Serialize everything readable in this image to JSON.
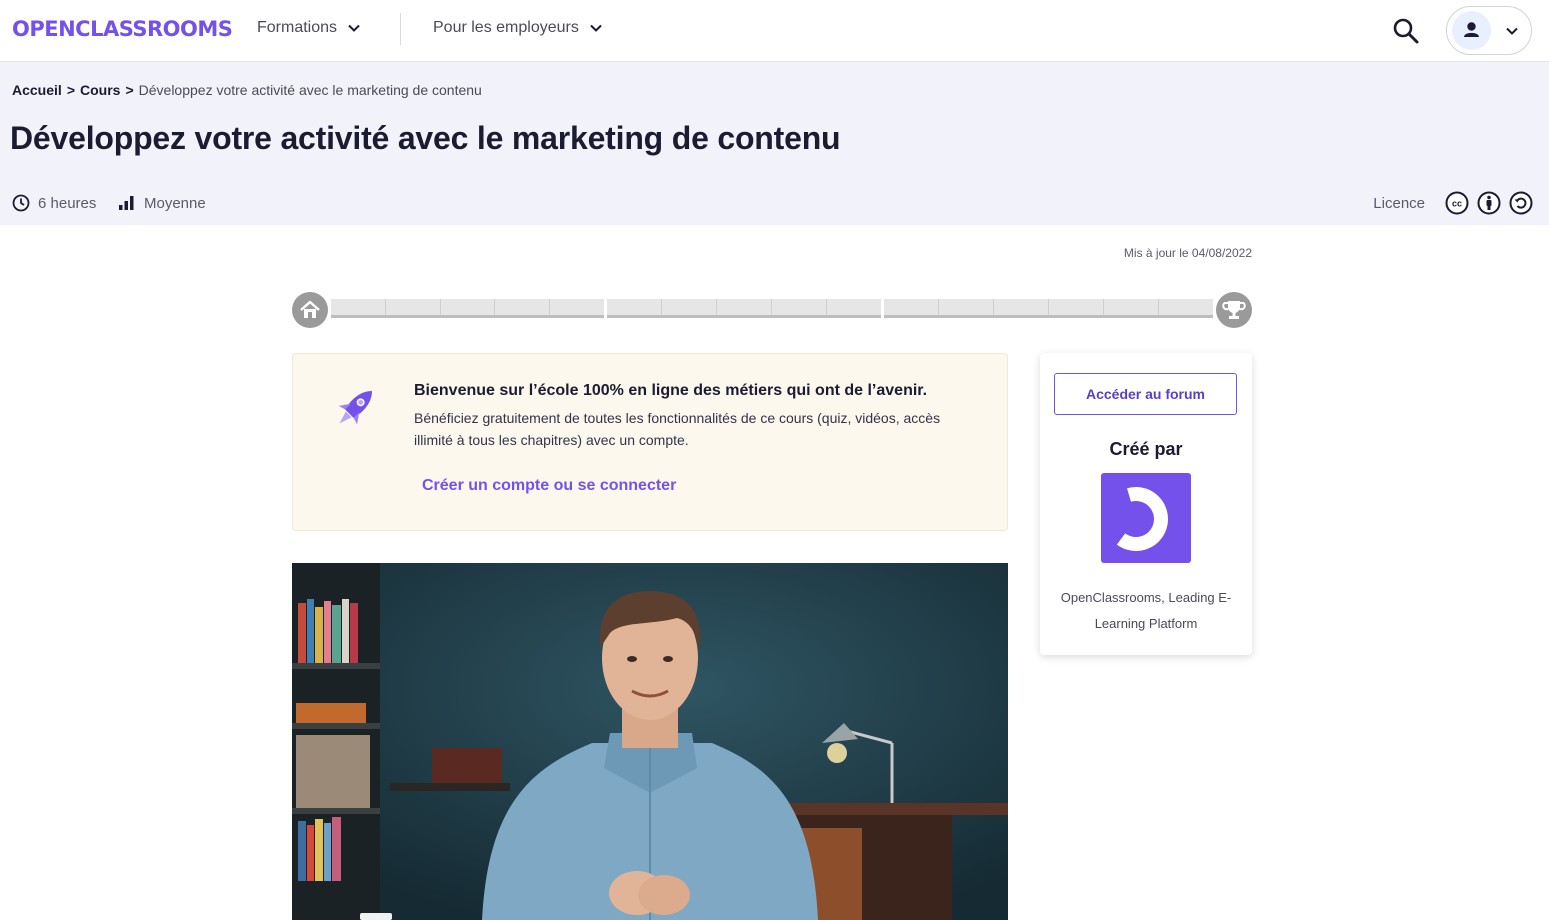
{
  "nav": {
    "logo": "OPENCLASSROOMS",
    "formations": "Formations",
    "employeurs": "Pour les employeurs"
  },
  "breadcrumb": {
    "home": "Accueil",
    "sep1": ">",
    "cours": "Cours",
    "sep2": ">",
    "current": "Développez votre activité avec le marketing de contenu"
  },
  "course": {
    "title": "Développez votre activité avec le marketing de contenu",
    "duration": "6 heures",
    "difficulty": "Moyenne",
    "licence_label": "Licence",
    "updated": "Mis à jour le 04/08/2022"
  },
  "progress": {
    "segments": 3,
    "completed": 0
  },
  "welcome": {
    "title": "Bienvenue sur l’école 100% en ligne des métiers qui ont de l’avenir.",
    "text": "Bénéficiez gratuitement de toutes les fonctionnalités de ce cours (quiz, vidéos, accès illimité à tous les chapitres) avec un compte.",
    "cta": "Créer un compte ou se connecter"
  },
  "sidebar": {
    "forum_button": "Accéder au forum",
    "created_by": "Créé par",
    "author": "OpenClassrooms, Leading E-Learning Platform"
  },
  "colors": {
    "brand": "#7451eb",
    "header_bg": "#f2f2fa",
    "banner_bg": "#fcf8ed"
  },
  "icons": [
    "chevron-down-icon",
    "search-icon",
    "user-icon",
    "clock-icon",
    "difficulty-bars-icon",
    "cc-icon",
    "by-icon",
    "sa-icon",
    "home-icon",
    "trophy-icon",
    "rocket-icon"
  ]
}
